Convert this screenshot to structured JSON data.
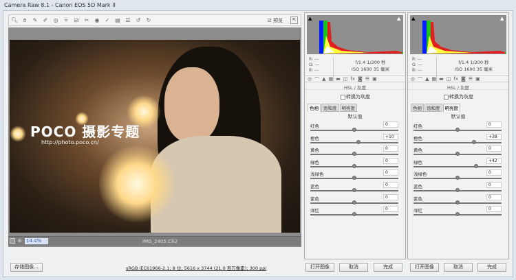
{
  "window": {
    "title": "Camera Raw 8.1  -  Canon EOS 5D Mark II"
  },
  "toolbar": {
    "tools": [
      "zoom-icon",
      "hand-icon",
      "white-balance-icon",
      "color-sampler-icon",
      "target-adjust-icon",
      "crop-icon",
      "straighten-icon",
      "spot-removal-icon",
      "red-eye-icon",
      "adjustment-brush-icon",
      "graduated-filter-icon",
      "radial-filter-icon",
      "rotate-left-icon",
      "rotate-right-icon"
    ],
    "preview_label": "预览"
  },
  "preview": {
    "watermark": "POCO 摄影专题",
    "watermark_url": "http://photo.poco.cn/",
    "zoom_value": "14.4%",
    "filename": "IMG_2405.CR2"
  },
  "panels": [
    {
      "rgb": [
        "R: ---",
        "G: ---",
        "B: ---"
      ],
      "exif1": "f/1.4   1/200 秒",
      "exif2": "ISO 1600   35 毫米",
      "tabs": [
        "◎",
        "⌒",
        "▲",
        "▦",
        "▬",
        "◫",
        "fx",
        "◙",
        "☰",
        "▣"
      ],
      "header": "HSL / 灰度",
      "grayscale": "转换为灰度",
      "subtabs": [
        "色相",
        "饱和度",
        "明亮度"
      ],
      "active_subtab": 0,
      "default": "默认值",
      "rows": [
        {
          "label": "红色",
          "value": "0"
        },
        {
          "label": "橙色",
          "value": "+10"
        },
        {
          "label": "黄色",
          "value": "0"
        },
        {
          "label": "绿色",
          "value": "0"
        },
        {
          "label": "浅绿色",
          "value": "0"
        },
        {
          "label": "蓝色",
          "value": "0"
        },
        {
          "label": "紫色",
          "value": "0"
        },
        {
          "label": "洋红",
          "value": "0"
        }
      ]
    },
    {
      "rgb": [
        "R: ---",
        "G: ---",
        "B: ---"
      ],
      "exif1": "f/1.4   1/200 秒",
      "exif2": "ISO 1600   35 毫米",
      "tabs": [
        "◎",
        "⌒",
        "▲",
        "▦",
        "▬",
        "◫",
        "fx",
        "◙",
        "☰",
        "▣"
      ],
      "header": "HSL / 灰度",
      "grayscale": "转换为灰度",
      "subtabs": [
        "色相",
        "饱和度",
        "明亮度"
      ],
      "active_subtab": 2,
      "default": "默认值",
      "rows": [
        {
          "label": "红色",
          "value": "0"
        },
        {
          "label": "橙色",
          "value": "+38"
        },
        {
          "label": "黄色",
          "value": "0"
        },
        {
          "label": "绿色",
          "value": "+42"
        },
        {
          "label": "浅绿色",
          "value": "0"
        },
        {
          "label": "蓝色",
          "value": "0"
        },
        {
          "label": "紫色",
          "value": "0"
        },
        {
          "label": "洋红",
          "value": "0"
        }
      ]
    }
  ],
  "footer": {
    "save": "存储图像...",
    "info": "sRGB IEC61966-2.1; 8 位; 5616 x 3744 (21.0 百万像素); 300 ppi",
    "open": "打开图像",
    "cancel": "取消",
    "done": "完成"
  }
}
